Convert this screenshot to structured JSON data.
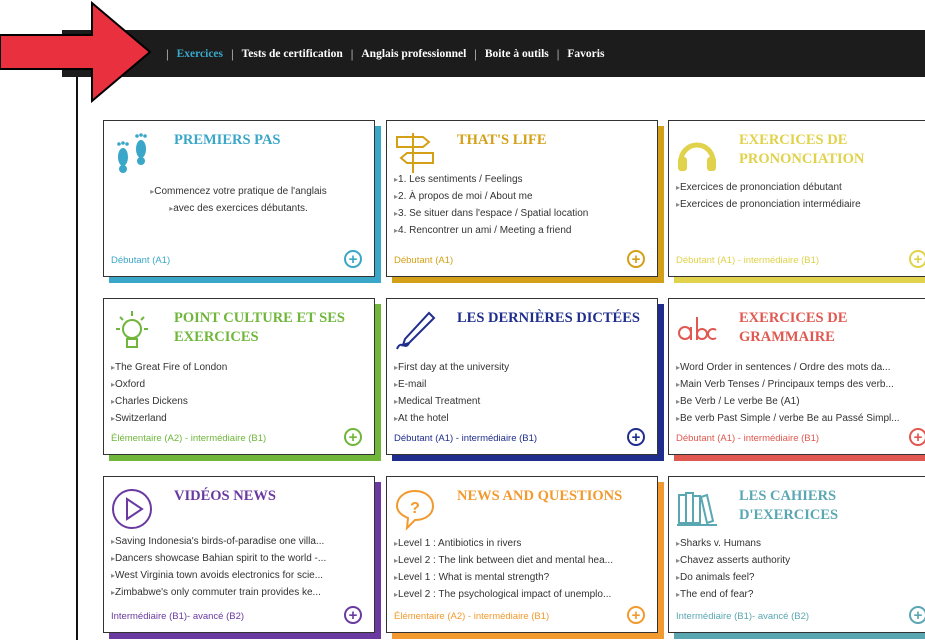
{
  "nav": {
    "items": [
      "Exercices",
      "Tests de certification",
      "Anglais professionnel",
      "Boite à outils",
      "Favoris"
    ],
    "active": "Exercices"
  },
  "colors": {
    "blue": "#3aa7c8",
    "gold": "#d4a017",
    "yellow": "#e0d24a",
    "green": "#6fb63b",
    "navy": "#1f2e8c",
    "coral": "#e0584f",
    "purple": "#6a3aa0",
    "orange": "#f29a2e",
    "teal": "#5aa7b2",
    "red_arrow": "#e8303f"
  },
  "cards": [
    {
      "title": "PREMIERS PAS",
      "icon": "footprints-icon",
      "items": [
        "Commencez votre pratique de l'anglais",
        "avec des exercices débutants."
      ],
      "level": "Débutant (A1)"
    },
    {
      "title": "THAT'S LIFE",
      "icon": "signpost-icon",
      "items": [
        "1. Les sentiments / Feelings",
        "2. À propos de moi / About me",
        "3. Se situer dans l'espace / Spatial location",
        "4. Rencontrer un ami / Meeting a friend"
      ],
      "level": "Débutant (A1)"
    },
    {
      "title": "EXERCICES DE PRONONCIATION",
      "icon": "headphones-icon",
      "items": [
        "Exercices de prononciation débutant",
        "Exercices de prononciation intermédiaire"
      ],
      "level": "Débutant (A1) - intermédiaire (B1)"
    },
    {
      "title": "POINT CULTURE ET SES EXERCICES",
      "icon": "lightbulb-icon",
      "items": [
        "The Great Fire of London",
        "Oxford",
        "Charles Dickens",
        "Switzerland"
      ],
      "level": "Élémentaire (A2) - intermédiaire (B1)"
    },
    {
      "title": "LES DERNIÈRES DICTÉES",
      "icon": "pen-icon",
      "items": [
        "First day at the university",
        "E-mail",
        "Medical Treatment",
        "At the hotel"
      ],
      "level": "Débutant (A1) - intermédiaire (B1)"
    },
    {
      "title": "EXERCICES DE GRAMMAIRE",
      "icon": "abc-icon",
      "items": [
        "Word Order in sentences / Ordre des mots da...",
        "Main Verb Tenses / Principaux temps des verb...",
        "Be Verb / Le verbe Be (A1)",
        "Be verb Past Simple / verbe Be au Passé Simpl..."
      ],
      "level": "Débutant (A1) - intermédiaire (B1)"
    },
    {
      "title": "VIDÉOS NEWS",
      "icon": "play-icon",
      "items": [
        "Saving Indonesia's birds-of-paradise one villa...",
        "Dancers showcase Bahian spirit to the world -...",
        "West Virginia town avoids electronics for scie...",
        "Zimbabwe's only commuter train provides ke..."
      ],
      "level": "Intermédiaire (B1)- avancé (B2)"
    },
    {
      "title": "NEWS AND QUESTIONS",
      "icon": "speech-bubble-icon",
      "items": [
        "Level 1 : Antibiotics in rivers",
        "Level 2 : The link between diet and mental hea...",
        "Level 1 : What is mental strength?",
        "Level 2 : The psychological impact of unemplo..."
      ],
      "level": "Élémentaire (A2) - intermédiaire (B1)"
    },
    {
      "title": "LES CAHIERS D'EXERCICES",
      "icon": "books-icon",
      "items": [
        "Sharks v. Humans",
        "Chavez asserts authority",
        "Do animals feel?",
        "The end of fear?"
      ],
      "level": "Intermédiaire (B1)- avancé (B2)"
    }
  ]
}
